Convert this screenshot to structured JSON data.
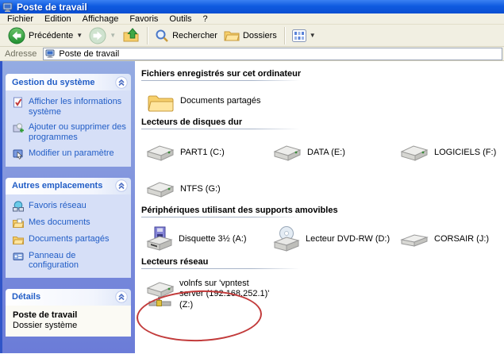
{
  "window": {
    "title": "Poste de travail"
  },
  "menu": {
    "items": [
      "Fichier",
      "Edition",
      "Affichage",
      "Favoris",
      "Outils",
      "?"
    ]
  },
  "toolbar": {
    "back_label": "Précédente",
    "search_label": "Rechercher",
    "folders_label": "Dossiers",
    "icons": [
      "back-icon",
      "forward-icon",
      "up-folder-icon",
      "search-icon",
      "folders-icon",
      "views-icon"
    ]
  },
  "address": {
    "label": "Adresse",
    "value": "Poste de travail",
    "icon": "my-computer-icon"
  },
  "sidebar": {
    "panels": [
      {
        "title": "Gestion du système",
        "items": [
          {
            "icon": "system-info-icon",
            "label": "Afficher les informations système"
          },
          {
            "icon": "add-remove-programs-icon",
            "label": "Ajouter ou supprimer des programmes"
          },
          {
            "icon": "change-setting-icon",
            "label": "Modifier un paramètre"
          }
        ]
      },
      {
        "title": "Autres emplacements",
        "items": [
          {
            "icon": "network-places-icon",
            "label": "Favoris réseau"
          },
          {
            "icon": "my-documents-icon",
            "label": "Mes documents"
          },
          {
            "icon": "shared-documents-icon",
            "label": "Documents partagés"
          },
          {
            "icon": "control-panel-icon",
            "label": "Panneau de configuration"
          }
        ]
      },
      {
        "title": "Détails",
        "details": {
          "name": "Poste de travail",
          "type": "Dossier système"
        }
      }
    ]
  },
  "main": {
    "sections": [
      {
        "title": "Fichiers enregistrés sur cet ordinateur",
        "items": [
          {
            "icon": "shared-folder-icon",
            "label": "Documents partagés"
          }
        ]
      },
      {
        "title": "Lecteurs de disques dur",
        "items": [
          {
            "icon": "hard-drive-icon",
            "label": "PART1 (C:)"
          },
          {
            "icon": "hard-drive-icon",
            "label": "DATA (E:)"
          },
          {
            "icon": "hard-drive-icon",
            "label": "LOGICIELS (F:)"
          },
          {
            "icon": "hard-drive-icon",
            "label": "NTFS (G:)"
          }
        ]
      },
      {
        "title": "Périphériques utilisant des supports amovibles",
        "items": [
          {
            "icon": "floppy-drive-icon",
            "label": "Disquette 3½ (A:)"
          },
          {
            "icon": "dvd-drive-icon",
            "label": "Lecteur DVD-RW (D:)"
          },
          {
            "icon": "removable-drive-icon",
            "label": "CORSAIR (J:)"
          }
        ]
      },
      {
        "title": "Lecteurs réseau",
        "items": [
          {
            "icon": "network-drive-icon",
            "label": "volnfs sur 'vpntest server (192.168.252.1)' (Z:)"
          }
        ]
      }
    ]
  },
  "annotation": {
    "type": "ellipse",
    "color": "#C23B3B"
  },
  "colors": {
    "titlebar_blue": "#0F5BE0",
    "taskpane_background": "#7C8EDC",
    "taskpane_panel": "#D6DFF7",
    "taskpane_link": "#215DC6",
    "chrome_beige": "#F1EFE2",
    "annotation_red": "#C23B3B"
  }
}
